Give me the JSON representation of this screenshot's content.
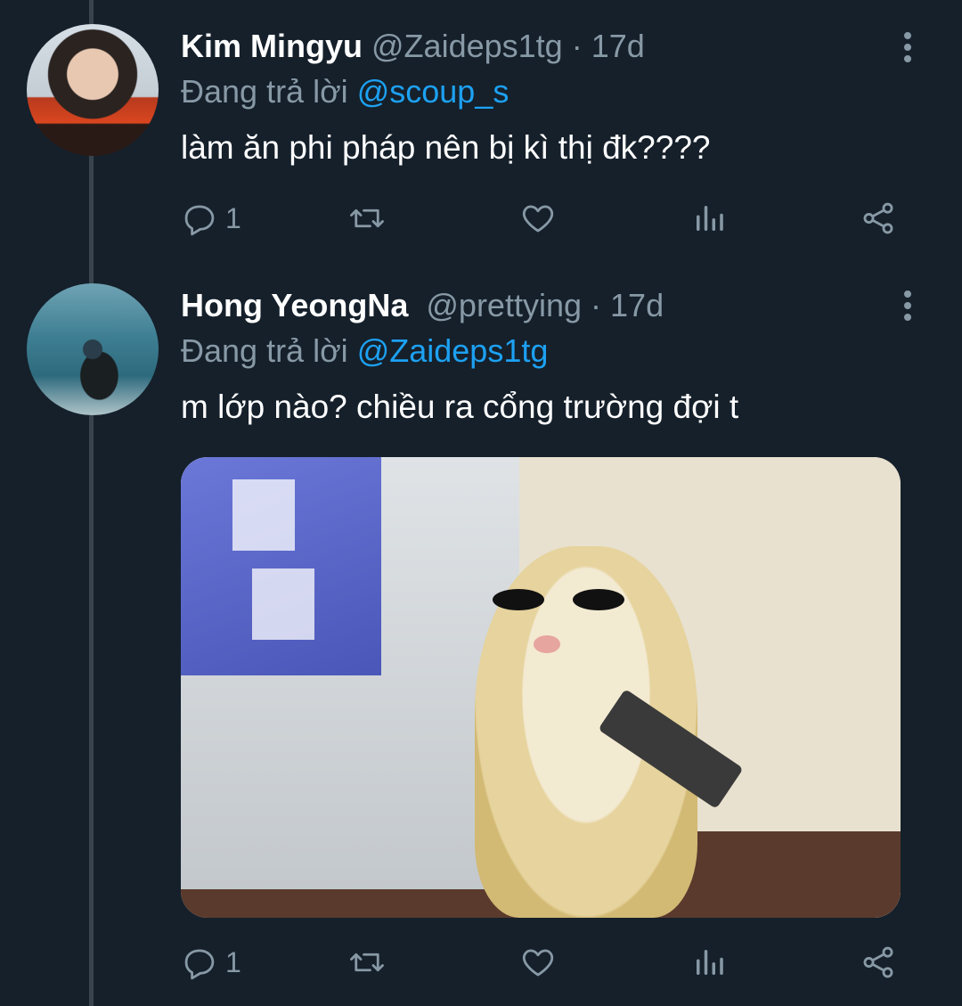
{
  "tweets": [
    {
      "name": "Kim Mingyu",
      "handle": "@Zaideps1tg",
      "separator": "·",
      "time": "17d",
      "reply_prefix": "Đang trả lời",
      "reply_to": "@scoup_s",
      "text": "làm ăn phi pháp nên bị kì thị đk????",
      "reply_count": "1"
    },
    {
      "name": "Hong YeongNa",
      "handle": "@prettying",
      "separator": "·",
      "time": "17d",
      "reply_prefix": "Đang trả lời",
      "reply_to": "@Zaideps1tg",
      "text": "m lớp nào? chiều ra cổng trường đợi t",
      "reply_count": "1"
    }
  ],
  "colors": {
    "background": "#15202b",
    "muted": "#8899a6",
    "accent": "#1da1f2",
    "thread_line": "#38444d"
  },
  "icons": [
    "reply-icon",
    "retweet-icon",
    "like-icon",
    "analytics-icon",
    "share-icon",
    "more-options-icon"
  ]
}
